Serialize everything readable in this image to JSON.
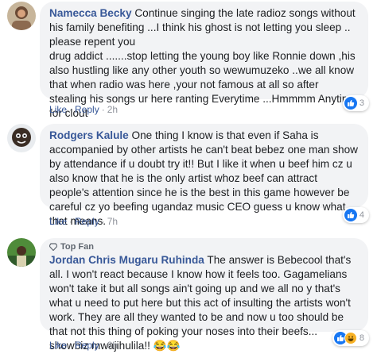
{
  "comments": [
    {
      "author": "Namecca Becky",
      "badge": "",
      "text": "Continue singing the late radioz songs without his family benefiting ...I think his ghost is not letting you sleep .. please repent you\ndrug addict .......stop letting the young boy like Ronnie down ,his also hustling like any other youth so wewumuzeko ..we all know that when radio was here ,your not famous at all so after stealing his songs ur here ranting Everytime ...Hmmmm Anytime for clout",
      "like_label": "Like",
      "reply_label": "Reply",
      "time": "2h",
      "reaction_count": "3",
      "reaction_icons": [
        "like-icon"
      ]
    },
    {
      "author": "Rodgers Kalule",
      "badge": "",
      "text": "One thing I know is that even if Saha is accompanied by other artists he can't beat bebez one man show by attendance if u doubt try it!! But I like it when u beef him cz u also know that he is the only artist whoz beef can attract people's attention since he is the best in this game however be careful cz yo beefing ugandaz music CEO guess u know what that means.",
      "like_label": "Like",
      "reply_label": "Reply",
      "time": "7h",
      "reaction_count": "4",
      "reaction_icons": [
        "like-icon"
      ]
    },
    {
      "author": "Jordan Chris Mugaru Ruhinda",
      "badge": "Top Fan",
      "text": "The answer is Bebecool that's all. I won't react because I know how it feels too. Gagamelians won't take it but all songs ain't going up and we all no y that's what u need to put here but this act of insulting the artists won't work. They are all they wanted to be and now u too should be that not this thing of poking your noses into their beefs... showbiz mwajihulila!! 😂😂",
      "like_label": "Like",
      "reply_label": "Reply",
      "time": "8h",
      "reaction_count": "8",
      "reaction_icons": [
        "like-icon",
        "haha-icon"
      ]
    }
  ],
  "colors": {
    "author": "#385898",
    "bubble": "#f2f3f5",
    "meta": "#90949c",
    "like": "#1877f2",
    "haha": "#f7b125"
  }
}
